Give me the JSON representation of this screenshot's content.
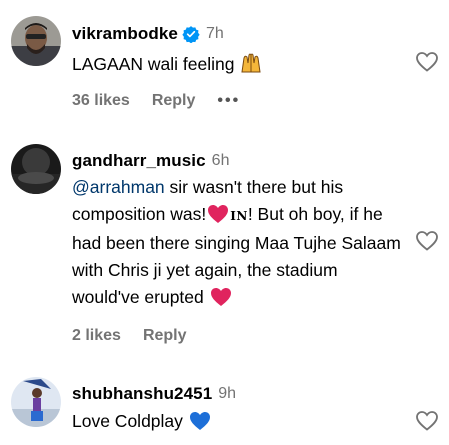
{
  "comments": [
    {
      "username": "vikrambodke",
      "verified": true,
      "time": "7h",
      "text": "LAGAAN wali feeling",
      "likes": "36 likes",
      "reply": "Reply",
      "more": "•••"
    },
    {
      "username": "gandharr_music",
      "verified": false,
      "time": "6h",
      "mention": "@arrahman",
      "text_part1": " sir wasn't there but his composition was!",
      "in_glyph": "IN",
      "text_part2": "! But oh boy, if he had been there singing Maa Tujhe Salaam with Chris ji yet again, the stadium would've erupted",
      "likes": "2 likes",
      "reply": "Reply"
    },
    {
      "username": "shubhanshu2451",
      "verified": false,
      "time": "9h",
      "text": "Love Coldplay"
    }
  ],
  "icons": {
    "like": "heart-outline-icon",
    "verified": "verified-badge-icon",
    "colors": {
      "verified": "#0095f6",
      "red_heart": "#e0245e",
      "blue_heart": "#1d6fd8"
    }
  }
}
